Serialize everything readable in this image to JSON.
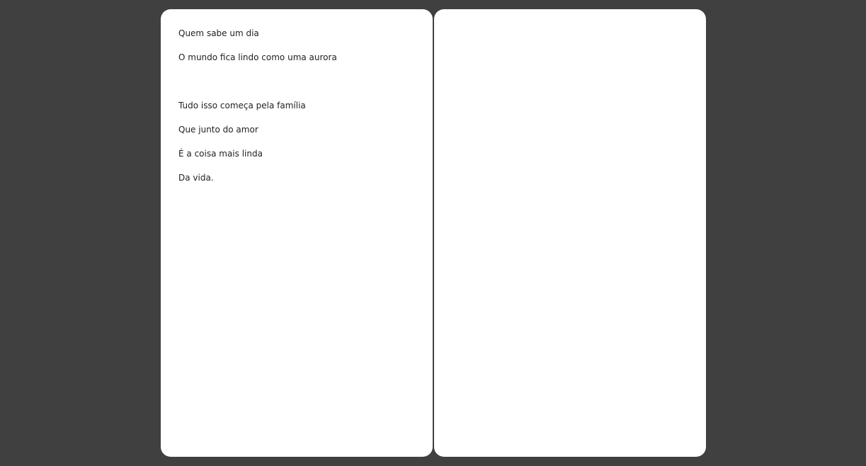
{
  "colors": {
    "background": "#404040",
    "page": "#ffffff",
    "text": "#222222"
  },
  "book": {
    "left_page": {
      "lines": [
        "Quem sabe um dia",
        "O mundo fica lindo como uma aurora",
        "",
        "Tudo isso começa pela família",
        "Que junto do amor",
        "É a coisa mais linda",
        "Da vida."
      ]
    },
    "right_page": {
      "lines": []
    }
  }
}
